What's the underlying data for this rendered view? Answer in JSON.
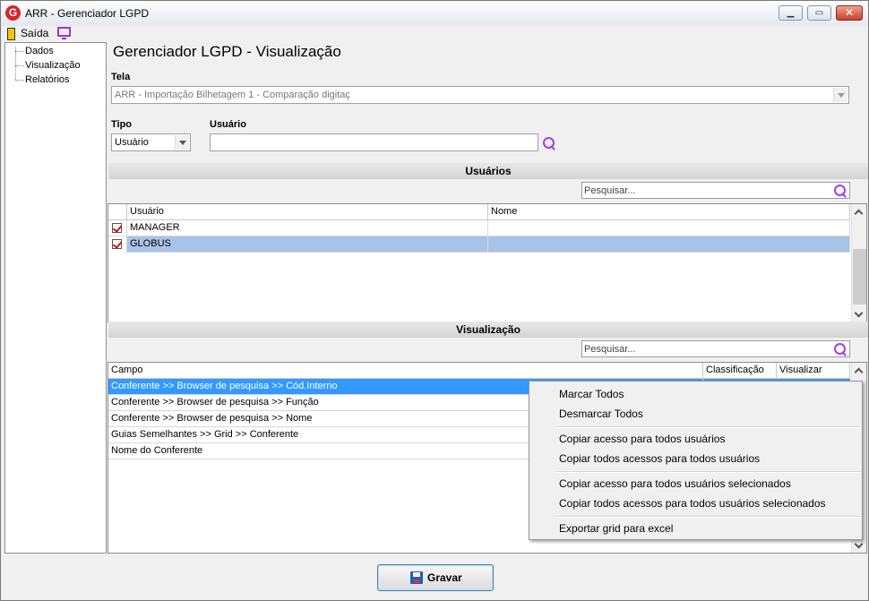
{
  "window": {
    "title": "ARR - Gerenciador LGPD",
    "logo_letter": "G",
    "minimize": "▁",
    "maximize": "▭",
    "close": "✕"
  },
  "toolbar": {
    "exit_label": "Saída"
  },
  "tree": {
    "items": [
      "Dados",
      "Visualização",
      "Relatórios"
    ]
  },
  "page": {
    "title": "Gerenciador LGPD - Visualização"
  },
  "form": {
    "tela_label": "Tela",
    "tela_value": "ARR - Importação Bilhetagem 1 - Comparação digitaç",
    "tipo_label": "Tipo",
    "tipo_value": "Usuário",
    "usuario_label": "Usuário",
    "usuario_value": ""
  },
  "usuarios": {
    "header": "Usuários",
    "search_placeholder": "Pesquisar...",
    "columns": [
      "Usuário",
      "Nome"
    ],
    "rows": [
      {
        "usuario": "MANAGER",
        "nome": "",
        "checked": true
      },
      {
        "usuario": "GLOBUS",
        "nome": "",
        "checked": true
      }
    ]
  },
  "visualizacao": {
    "header": "Visualização",
    "search_placeholder": "Pesquisar...",
    "columns": [
      "Campo",
      "Classificação",
      "Visualizar"
    ],
    "rows": [
      "Conferente >> Browser de pesquisa >> Cód.Interno",
      "Conferente >> Browser de pesquisa >> Função",
      "Conferente >> Browser de pesquisa >> Nome",
      "Guias Semelhantes >> Grid >> Conferente",
      "Nome do Conferente"
    ]
  },
  "context_menu": {
    "items": [
      "Marcar Todos",
      "Desmarcar Todos",
      "Copiar acesso para todos usuários",
      "Copiar todos acessos para todos usuários",
      "Copiar acesso para todos usuários selecionados",
      "Copiar todos acessos para todos usuários selecionados",
      "Exportar grid para excel"
    ]
  },
  "footer": {
    "save_label": "Gravar"
  },
  "colors": {
    "selection_blue": "#3399ff",
    "selected_row": "#a9c2e8",
    "accent_purple": "#a33ee8"
  }
}
